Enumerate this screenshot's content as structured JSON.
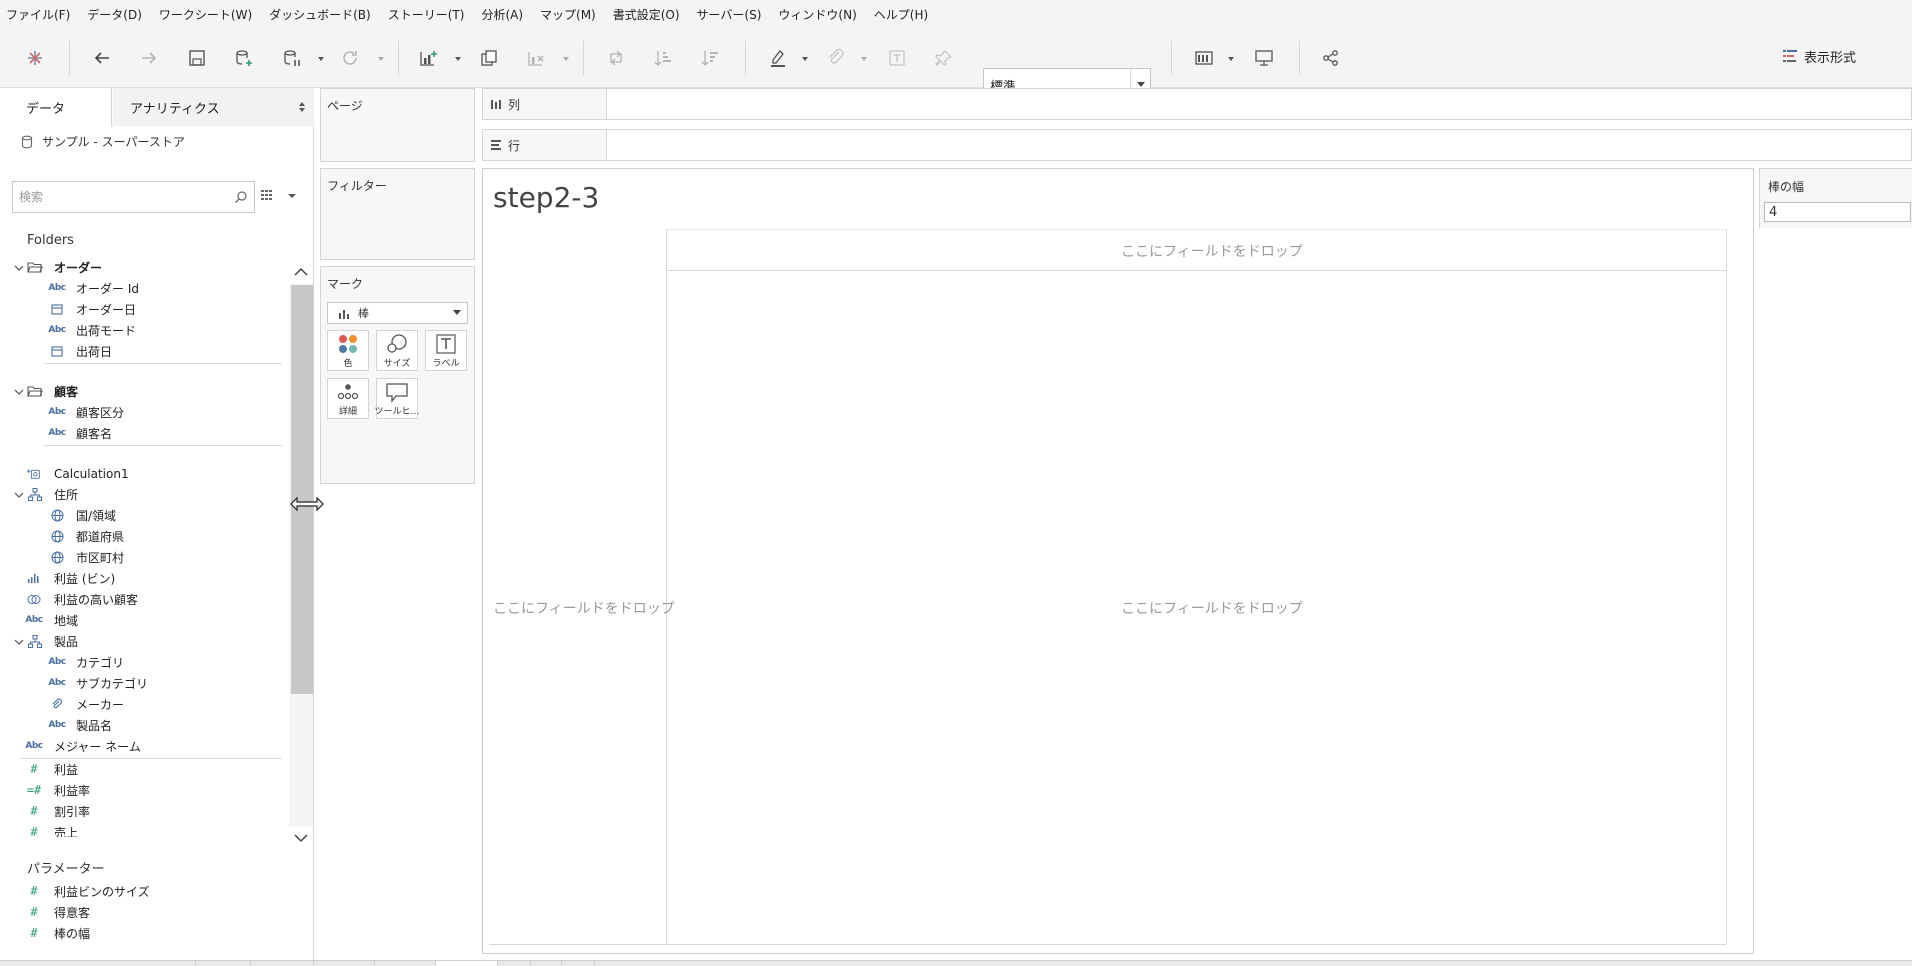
{
  "menu": [
    "ファイル(F)",
    "データ(D)",
    "ワークシート(W)",
    "ダッシュボード(B)",
    "ストーリー(T)",
    "分析(A)",
    "マップ(M)",
    "書式設定(O)",
    "サーバー(S)",
    "ウィンドウ(N)",
    "ヘルプ(H)"
  ],
  "toolbar": {
    "fit_select": "標準",
    "show_me": "表示形式"
  },
  "left_pane": {
    "tab_data": "データ",
    "tab_analytics": "アナリティクス",
    "datasource": "サンプル - スーパーストア",
    "search_placeholder": "検索",
    "folders_label": "Folders",
    "parameters_label": "パラメーター"
  },
  "tree": {
    "order_folder": "オーダー",
    "order_id": "オーダー Id",
    "order_date": "オーダー日",
    "ship_mode": "出荷モード",
    "ship_date": "出荷日",
    "customer_folder": "顧客",
    "customer_segment": "顧客区分",
    "customer_name": "顧客名",
    "calc1": "Calculation1",
    "address": "住所",
    "country": "国/領域",
    "prefecture": "都道府県",
    "city": "市区町村",
    "profit_bin": "利益 (ビン)",
    "high_profit_customers": "利益の高い顧客",
    "region": "地域",
    "product": "製品",
    "category": "カテゴリ",
    "subcategory": "サブカテゴリ",
    "maker": "メーカー",
    "product_name": "製品名",
    "measure_names": "メジャー ネーム",
    "profit": "利益",
    "profit_ratio": "利益率",
    "discount": "割引率",
    "sales": "売上"
  },
  "parameters": {
    "profit_bin_size": "利益ビンのサイズ",
    "top_customers": "得意客",
    "bar_width": "棒の幅"
  },
  "shelves": {
    "pages": "ページ",
    "filters": "フィルター",
    "marks": "マーク",
    "mark_type": "棒",
    "color": "色",
    "size": "サイズ",
    "label": "ラベル",
    "detail": "詳細",
    "tooltip": "ツールヒ…",
    "columns": "列",
    "rows": "行"
  },
  "view": {
    "title": "step2-3",
    "drop_top": "ここにフィールドをドロップ",
    "drop_left": "ここにフィールドをドロップ",
    "drop_center": "ここにフィールドをドロップ"
  },
  "param_control": {
    "title": "棒の幅",
    "value": "4"
  },
  "colors": {
    "accent_green": "#2e9b7b",
    "dimension_blue": "#4a6fa5",
    "chrome_bg": "#f4f4f4"
  }
}
